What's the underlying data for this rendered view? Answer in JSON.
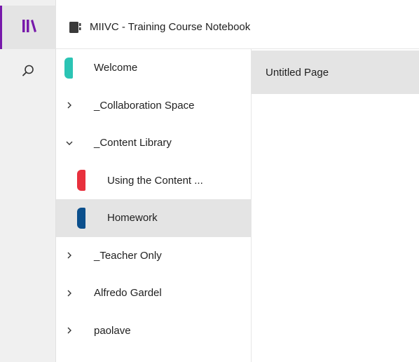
{
  "rail": {
    "notebooks_icon": "notebooks-library-icon",
    "search_icon": "search-icon",
    "accent_color": "#7719aa"
  },
  "header": {
    "notebook_title": "MIIVC - Training Course Notebook",
    "notebook_icon": "notebook-icon"
  },
  "sections": [
    {
      "label": "Welcome",
      "type": "section",
      "color": "#2bc4b4"
    },
    {
      "label": "_Collaboration Space",
      "type": "group",
      "expanded": false
    },
    {
      "label": "_Content Library",
      "type": "group",
      "expanded": true
    },
    {
      "label": "Using the Content ...",
      "type": "section",
      "color": "#e8303d",
      "child": true
    },
    {
      "label": "Homework",
      "type": "section",
      "color": "#0b4f8c",
      "child": true,
      "selected": true
    },
    {
      "label": "_Teacher Only",
      "type": "group",
      "expanded": false
    },
    {
      "label": "Alfredo Gardel",
      "type": "group",
      "expanded": false
    },
    {
      "label": "paolave",
      "type": "group",
      "expanded": false
    }
  ],
  "pages": [
    {
      "label": "Untitled Page",
      "selected": true
    }
  ]
}
